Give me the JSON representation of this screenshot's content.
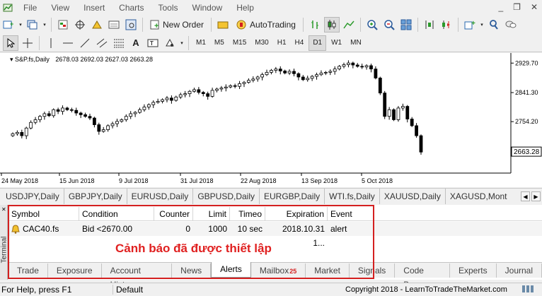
{
  "menu": [
    "File",
    "View",
    "Insert",
    "Charts",
    "Tools",
    "Window",
    "Help"
  ],
  "toolbar": {
    "new_order": "New Order",
    "autotrading": "AutoTrading"
  },
  "timeframes": [
    "M1",
    "M5",
    "M15",
    "M30",
    "H1",
    "H4",
    "D1",
    "W1",
    "MN"
  ],
  "active_timeframe": "D1",
  "chart": {
    "symbol": "S&P.fs,Daily",
    "ohlc": "2678.03 2692.03 2627.03 2663.28",
    "current_price": "2663.28"
  },
  "chart_data": {
    "type": "candlestick",
    "price_ticks": [
      "2929.70",
      "2841.30",
      "2754.20"
    ],
    "date_ticks": [
      "24 May 2018",
      "15 Jun 2018",
      "9 Jul 2018",
      "31 Jul 2018",
      "22 Aug 2018",
      "13 Sep 2018",
      "5 Oct 2018"
    ],
    "ylim": [
      2600,
      2960
    ],
    "closes": [
      2718,
      2722,
      2712,
      2735,
      2752,
      2760,
      2770,
      2778,
      2772,
      2790,
      2785,
      2795,
      2790,
      2788,
      2780,
      2775,
      2770,
      2765,
      2745,
      2725,
      2730,
      2742,
      2748,
      2755,
      2760,
      2770,
      2778,
      2782,
      2790,
      2798,
      2805,
      2812,
      2815,
      2820,
      2825,
      2818,
      2828,
      2835,
      2838,
      2845,
      2850,
      2842,
      2838,
      2830,
      2848,
      2852,
      2855,
      2858,
      2862,
      2860,
      2868,
      2872,
      2878,
      2882,
      2888,
      2895,
      2902,
      2908,
      2912,
      2906,
      2900,
      2905,
      2898,
      2888,
      2880,
      2884,
      2890,
      2895,
      2900,
      2902,
      2905,
      2912,
      2920,
      2925,
      2930,
      2924,
      2920,
      2918,
      2922,
      2912,
      2885,
      2840,
      2770,
      2790,
      2760,
      2795,
      2800,
      2762,
      2742,
      2712,
      2663
    ]
  },
  "symbol_tabs": [
    "USDJPY,Daily",
    "GBPJPY,Daily",
    "EURUSD,Daily",
    "GBPUSD,Daily",
    "EURGBP,Daily",
    "WTI.fs,Daily",
    "XAUUSD,Daily",
    "XAGUSD,Mont"
  ],
  "alerts": {
    "columns": [
      "Symbol",
      "Condition",
      "Counter",
      "Limit",
      "Timeo",
      "Expiration",
      "Event"
    ],
    "rows": [
      {
        "symbol": "CAC40.fs",
        "condition": "Bid <2670.00",
        "counter": "0",
        "limit": "1000",
        "timeout": "10 sec",
        "expiration": "2018.10.31 1...",
        "event": "alert"
      }
    ]
  },
  "annotation": "Cảnh báo đã được thiết lập",
  "terminal_label": "Terminal",
  "tabs": [
    "Trade",
    "Exposure",
    "Account History",
    "News",
    "Alerts",
    "Mailbox",
    "Market",
    "Signals",
    "Code Base",
    "Experts",
    "Journal"
  ],
  "active_tab": "Alerts",
  "mailbox_count": "25",
  "status": {
    "help": "For Help, press F1",
    "profile": "Default",
    "copyright": "Copyright 2018 - LearnToTradeTheMarket.com"
  }
}
